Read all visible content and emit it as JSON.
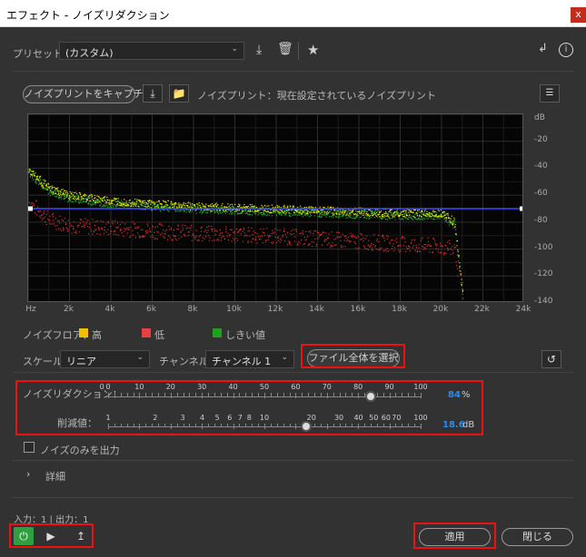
{
  "window": {
    "title": "エフェクト - ノイズリダクション",
    "close": "x"
  },
  "preset": {
    "label": "プリセット：",
    "value": "(カスタム)"
  },
  "noiseprint": {
    "capture_label": "ノイズプリントをキャプチャ",
    "status": "ノイズプリント：現在設定されているノイズプリント"
  },
  "chart_data": {
    "type": "line",
    "xlabel": "",
    "ylabel": "",
    "x_tick_labels": [
      "Hz",
      "2k",
      "4k",
      "6k",
      "8k",
      "10k",
      "12k",
      "14k",
      "16k",
      "18k",
      "20k",
      "22k",
      "24k"
    ],
    "y_tick_labels": [
      "dB",
      "-20",
      "-40",
      "-60",
      "-80",
      "-100",
      "-120",
      "-140"
    ],
    "xlim": [
      0,
      24000
    ],
    "ylim": [
      -140,
      0
    ],
    "series": [
      {
        "name": "高",
        "color": "#e8e800",
        "x": [
          0,
          1000,
          2000,
          4000,
          6000,
          8000,
          10000,
          12000,
          14000,
          16000,
          18000,
          20000,
          20600,
          21000
        ],
        "y": [
          -41,
          -55,
          -60,
          -64,
          -66,
          -68,
          -69,
          -70,
          -71,
          -72,
          -73,
          -73,
          -80,
          -135
        ]
      },
      {
        "name": "低",
        "color": "#e03030",
        "x": [
          0,
          1000,
          2000,
          4000,
          6000,
          8000,
          10000,
          12000,
          14000,
          16000,
          18000,
          20000,
          20600,
          21000
        ],
        "y": [
          -65,
          -78,
          -82,
          -84,
          -86,
          -88,
          -89,
          -90,
          -92,
          -94,
          -96,
          -98,
          -100,
          -135
        ]
      },
      {
        "name": "しきい値",
        "color": "#22b022",
        "x": [
          0,
          1000,
          2000,
          4000,
          6000,
          8000,
          10000,
          12000,
          14000,
          16000,
          18000,
          20000,
          20600,
          21000
        ],
        "y": [
          -43,
          -57,
          -62,
          -66,
          -68,
          -70,
          -71,
          -72,
          -73,
          -74,
          -75,
          -75,
          -82,
          -135
        ]
      }
    ],
    "threshold_line_db": -70,
    "grid": true
  },
  "legend": {
    "title": "ノイズフロア：",
    "high": "高",
    "low": "低",
    "threshold": "しきい値",
    "high_color": "#f0c000",
    "low_color": "#e84040",
    "threshold_color": "#20a020"
  },
  "scale": {
    "label": "スケール：",
    "value": "リニア"
  },
  "channel": {
    "label": "チャンネル：",
    "value": "チャンネル 1"
  },
  "select_all_label": "ファイル全体を選択",
  "noise_reduction": {
    "label": "ノイズリダクション：",
    "ticks": [
      "0",
      "0",
      "10",
      "20",
      "30",
      "40",
      "50",
      "60",
      "70",
      "80",
      "90",
      "100"
    ],
    "value": "84",
    "unit": "%"
  },
  "reduce_by": {
    "label": "削減値：",
    "ticks": [
      "1",
      "2",
      "3",
      "4",
      "5",
      "6",
      "7",
      "8",
      "10",
      "20",
      "30",
      "40",
      "50",
      "60",
      "70",
      "100"
    ],
    "value": "18.6",
    "unit": "dB"
  },
  "output_noise_only": "ノイズのみを出力",
  "details": {
    "label": "詳細"
  },
  "io": "入力：1 | 出力：1",
  "apply_label": "適用",
  "close_label": "閉じる"
}
